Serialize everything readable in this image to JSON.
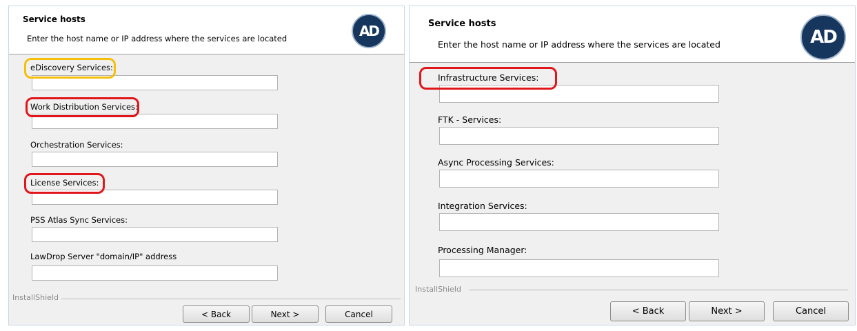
{
  "left_window": {
    "title": "Service hosts",
    "subtitle": "Enter the host name or IP address where the services are located",
    "logo_text": "AD",
    "fields": [
      {
        "label": "eDiscovery Services:",
        "value": "",
        "highlight": "yellow"
      },
      {
        "label": "Work Distribution Services:",
        "value": "",
        "highlight": "red"
      },
      {
        "label": "Orchestration Services:",
        "value": "",
        "highlight": "none"
      },
      {
        "label": "License Services:",
        "value": "",
        "highlight": "red"
      },
      {
        "label": "PSS Atlas Sync Services:",
        "value": "",
        "highlight": "none"
      },
      {
        "label": "LawDrop Server \"domain/IP\" address",
        "value": "",
        "highlight": "none"
      }
    ],
    "installshield": "InstallShield",
    "buttons": {
      "back": "< Back",
      "next": "Next >",
      "cancel": "Cancel"
    }
  },
  "right_window": {
    "title": "Service hosts",
    "subtitle": "Enter the host name or IP address where the services are located",
    "logo_text": "AD",
    "fields": [
      {
        "label": "Infrastructure Services:",
        "value": "",
        "highlight": "red"
      },
      {
        "label": "FTK - Services:",
        "value": "",
        "highlight": "none"
      },
      {
        "label": "Async Processing Services:",
        "value": "",
        "highlight": "none"
      },
      {
        "label": "Integration Services:",
        "value": "",
        "highlight": "none"
      },
      {
        "label": "Processing Manager:",
        "value": "",
        "highlight": "none"
      }
    ],
    "installshield": "InstallShield",
    "buttons": {
      "back": "< Back",
      "next": "Next >",
      "cancel": "Cancel"
    }
  },
  "colors": {
    "highlight_red": "#e0161b",
    "highlight_yellow": "#f5bf0a",
    "logo_bg": "#17365d"
  }
}
